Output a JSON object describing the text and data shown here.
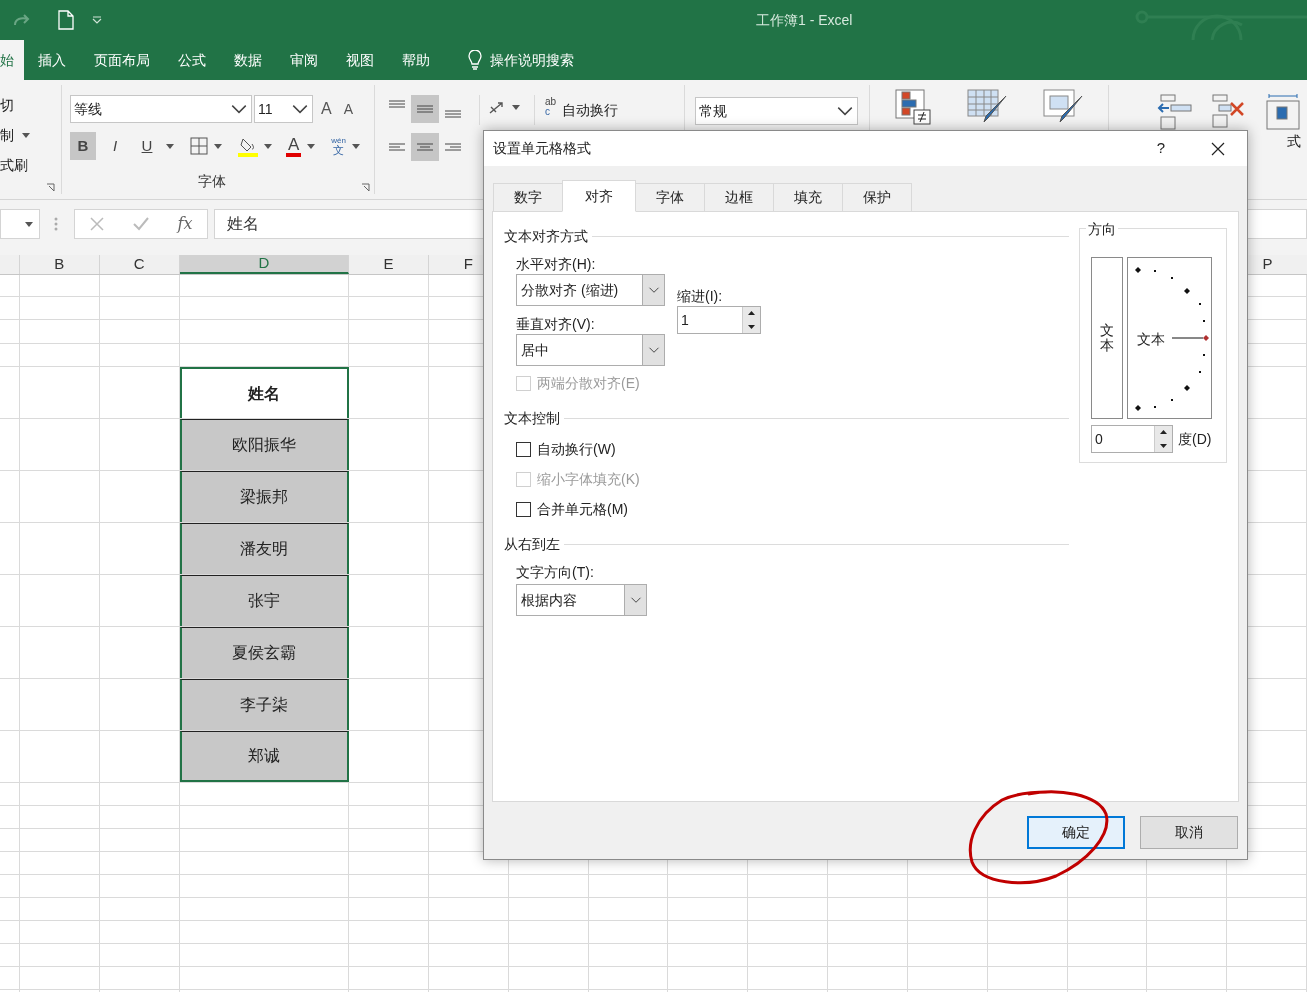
{
  "window": {
    "title": "工作簿1 - Excel"
  },
  "ribbon_tabs": [
    {
      "label": "始",
      "selected": true
    },
    {
      "label": "插入",
      "selected": false
    },
    {
      "label": "页面布局",
      "selected": false
    },
    {
      "label": "公式",
      "selected": false
    },
    {
      "label": "数据",
      "selected": false
    },
    {
      "label": "审阅",
      "selected": false
    },
    {
      "label": "视图",
      "selected": false
    },
    {
      "label": "帮助",
      "selected": false
    }
  ],
  "tell_me": "操作说明搜索",
  "clipboard": [
    "切",
    "制",
    "式刷"
  ],
  "font": {
    "name": "等线",
    "size": "11",
    "grow": "A",
    "shrink": "A",
    "group_label": "字体",
    "styles": [
      {
        "label": "B",
        "pressed": true
      },
      {
        "label": "I",
        "pressed": false
      },
      {
        "label": "U",
        "pressed": false
      }
    ],
    "font_color": "A",
    "phonetic_top": "wén",
    "phonetic_bottom": "文"
  },
  "alignment": {
    "vertical": [
      {
        "kind": "top",
        "selected": false
      },
      {
        "kind": "middle",
        "selected": true
      },
      {
        "kind": "bottom",
        "selected": false
      }
    ],
    "horizontal": [
      {
        "kind": "left",
        "selected": false
      },
      {
        "kind": "center",
        "selected": true
      },
      {
        "kind": "right",
        "selected": false
      }
    ],
    "wrap_icon_top": "ab",
    "wrap_icon_bottom": "c",
    "wrap_text": "自动换行"
  },
  "number_format": "常规",
  "cells_group_fragment": "式",
  "formula_bar": {
    "function_label": "fx",
    "value": "姓名"
  },
  "columns": [
    {
      "label": "B",
      "selected": false
    },
    {
      "label": "C",
      "selected": false
    },
    {
      "label": "D",
      "selected": true
    },
    {
      "label": "E",
      "selected": false
    },
    {
      "label": "F",
      "selected": false
    },
    {
      "label": "P",
      "selected": false
    }
  ],
  "name_list": {
    "header": "姓名",
    "items": [
      "欧阳振华",
      "梁振邦",
      "潘友明",
      "张宇",
      "夏侯玄霸",
      "李子柒",
      "郑诚"
    ]
  },
  "dialog": {
    "title": "设置单元格格式",
    "help": "?",
    "tabs": [
      {
        "label": "数字",
        "selected": false
      },
      {
        "label": "对齐",
        "selected": true
      },
      {
        "label": "字体",
        "selected": false
      },
      {
        "label": "边框",
        "selected": false
      },
      {
        "label": "填充",
        "selected": false
      },
      {
        "label": "保护",
        "selected": false
      }
    ],
    "text_alignment": {
      "title": "文本对齐方式",
      "horizontal_label": "水平对齐(H):",
      "horizontal_value": "分散对齐 (缩进)",
      "indent_label": "缩进(I):",
      "indent_value": "1",
      "vertical_label": "垂直对齐(V):",
      "vertical_value": "居中",
      "justify_distributed": {
        "label": "两端分散对齐(E)",
        "checked": false,
        "disabled": true
      }
    },
    "text_control": {
      "title": "文本控制",
      "options": [
        {
          "label": "自动换行(W)",
          "checked": false,
          "disabled": false
        },
        {
          "label": "缩小字体填充(K)",
          "checked": false,
          "disabled": true
        },
        {
          "label": "合并单元格(M)",
          "checked": false,
          "disabled": false
        }
      ]
    },
    "rtl": {
      "title": "从右到左",
      "direction_label": "文字方向(T):",
      "direction_value": "根据内容"
    },
    "orientation": {
      "title": "方向",
      "vertical_text": "文本",
      "dial_text": "文本",
      "degrees": "0",
      "degrees_label": "度(D)"
    },
    "buttons": [
      {
        "label": "确定",
        "default": true
      },
      {
        "label": "取消",
        "default": false
      }
    ]
  }
}
